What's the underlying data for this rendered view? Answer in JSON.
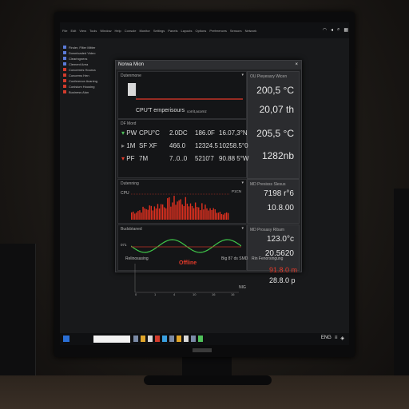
{
  "menubar": {
    "items": [
      "File",
      "Edit",
      "View",
      "Tools",
      "Window",
      "Help",
      "Console",
      "Monitor",
      "Settings",
      "Panels",
      "Layouts",
      "Options",
      "Preferences",
      "Sensors",
      "Network"
    ],
    "right_icons": [
      "wifi-icon",
      "volume-icon",
      "search-icon",
      "grid-icon"
    ]
  },
  "desktop": {
    "items": [
      {
        "label": "Finder, Filter Mitter",
        "icon_color": "#5b7bd8"
      },
      {
        "label": "Downloaded Video",
        "icon_color": "#5b7bd8"
      },
      {
        "label": "Clearingnexs",
        "icon_color": "#5b7bd8"
      },
      {
        "label": "Clement Area",
        "icon_color": "#5b7bd8"
      },
      {
        "label": "Concernes Hourna",
        "icon_color": "#d23b2c"
      },
      {
        "label": "Concerns Hen",
        "icon_color": "#d23b2c"
      },
      {
        "label": "Conference Avaning",
        "icon_color": "#d23b2c"
      },
      {
        "label": "Conisium Housing",
        "icon_color": "#d23b2c"
      },
      {
        "label": "Business Alan",
        "icon_color": "#d23b2c"
      }
    ]
  },
  "window": {
    "title": "Norwa Mion",
    "top_panel": {
      "title": "Dutenmone",
      "gpu_label": "CPU'T ernperisours",
      "extra": "corrit,acornz"
    },
    "right_panel": {
      "title": "OU Pieyesary Wicen",
      "values": [
        "200,5 °C",
        "20,07 th",
        "205,5 °C",
        "1282nb"
      ]
    },
    "table": {
      "header": "DF Mord",
      "rows": [
        {
          "label": "PW",
          "col1": "CPU°C",
          "col2": "2.0DC",
          "col3": "186.0F",
          "col4": "16.07,3°N"
        },
        {
          "label": "1M",
          "col1": "SF XF",
          "col2": "466.0",
          "col3": "12324.5",
          "col4": "10258.5°0"
        },
        {
          "label": "PF",
          "col1": "7M",
          "col2": "7..0..0",
          "col3": "5210'7",
          "col4": "90.88 5°W"
        }
      ]
    },
    "bars_panel": {
      "title": "Dutenning",
      "y_label": "CPU",
      "right_label": "P1CN",
      "side_title": "MD Presisss Slesus",
      "values": [
        "7198 r°6",
        "10.8.00"
      ]
    },
    "wave_panel": {
      "title": "Budsbtaned",
      "y_label": "071",
      "side_title": "MD Prosasy Ribam",
      "values": [
        "123.0°c",
        "20.5620"
      ],
      "status": "Offline"
    }
  },
  "lower": {
    "title": "Relinosasing",
    "middle_label": "Big 87 ds SMD",
    "right_label": "Rin Fenorsingung",
    "axis_labels": [
      "0",
      "1",
      "4",
      "10",
      "16",
      "16",
      "NIG"
    ],
    "values": [
      {
        "text": "91.8.0 m",
        "color": "#e23a2a"
      },
      {
        "text": "28.8.0 p",
        "color": "#e6e6e6"
      }
    ]
  },
  "taskbar": {
    "search_placeholder": "",
    "tray": [
      "ENG",
      "≡",
      "◈"
    ]
  }
}
